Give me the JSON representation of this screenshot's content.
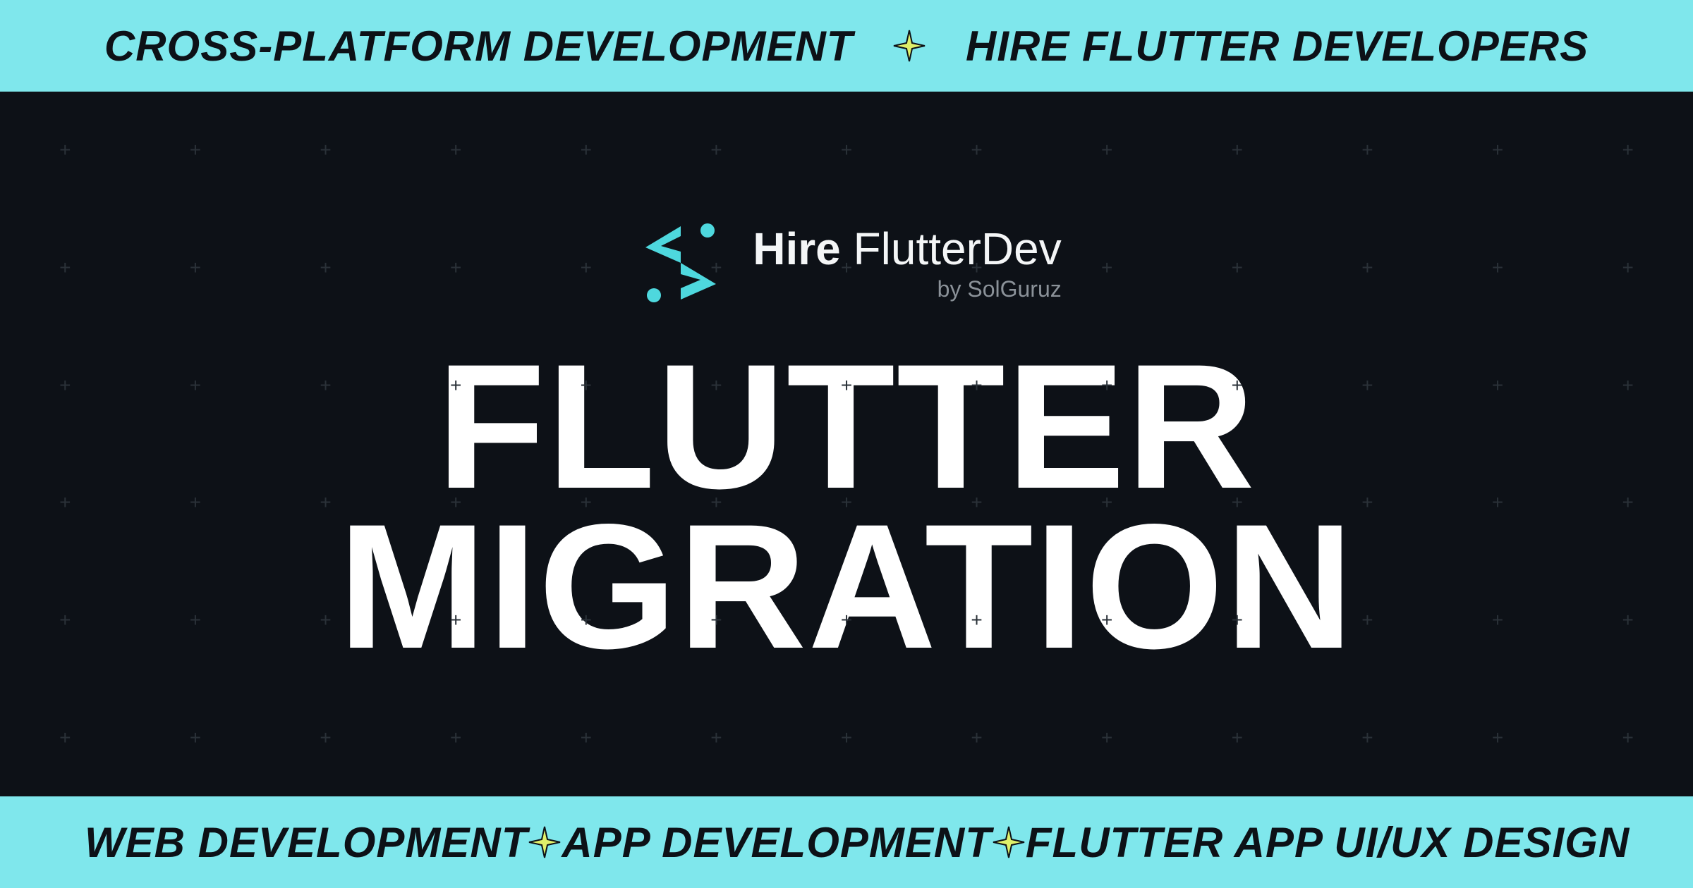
{
  "colors": {
    "banner_bg": "#7fe7ec",
    "hero_bg": "#0d1117",
    "banner_text": "#0d1117",
    "headline": "#ffffff",
    "accent": "#4ed8de",
    "sparkle_fill": "#dff06a",
    "sparkle_stroke": "#0d1117"
  },
  "top_banner": {
    "items": [
      "CROSS-PLATFORM DEVELOPMENT",
      "HIRE FLUTTER DEVELOPERS"
    ]
  },
  "bottom_banner": {
    "items": [
      "WEB DEVELOPMENT",
      "APP DEVELOPMENT",
      "FLUTTER APP UI/UX DESIGN"
    ]
  },
  "logo": {
    "title_bold": "Hire",
    "title_rest": " FlutterDev",
    "subtitle": "by SolGuruz"
  },
  "headline": "FLUTTER MIGRATION"
}
